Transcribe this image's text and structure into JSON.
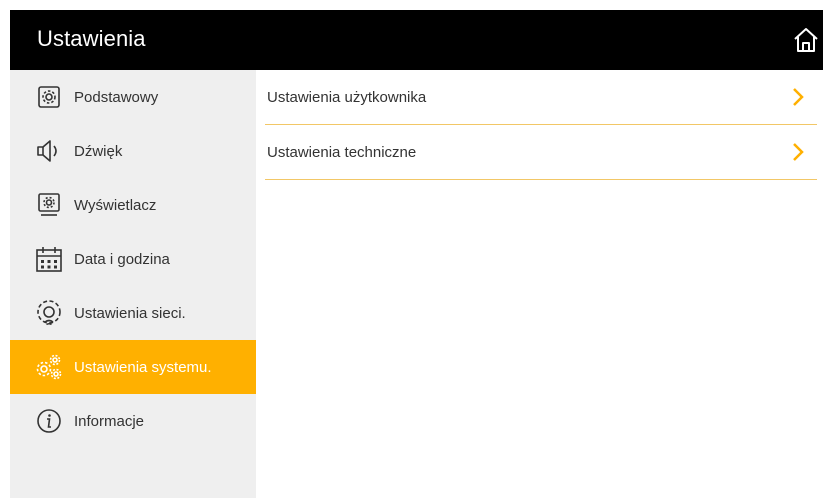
{
  "header": {
    "title": "Ustawienia",
    "home_icon": "home-icon"
  },
  "sidebar": {
    "items": [
      {
        "label": "Podstawowy",
        "icon": "gear-square-icon"
      },
      {
        "label": "Dźwięk",
        "icon": "speaker-icon"
      },
      {
        "label": "Wyświetlacz",
        "icon": "monitor-gear-icon"
      },
      {
        "label": "Data i godzina",
        "icon": "calendar-icon"
      },
      {
        "label": "Ustawienia sieci.",
        "icon": "network-gear-icon"
      },
      {
        "label": "Ustawienia systemu.",
        "icon": "gears-icon",
        "active": true
      },
      {
        "label": "Informacje",
        "icon": "info-icon"
      }
    ]
  },
  "main": {
    "rows": [
      {
        "label": "Ustawienia użytkownika"
      },
      {
        "label": "Ustawienia techniczne"
      }
    ]
  },
  "colors": {
    "accent": "#ffb000",
    "header_bg": "#000000",
    "sidebar_bg": "#efefef",
    "divider": "#f2c766"
  }
}
